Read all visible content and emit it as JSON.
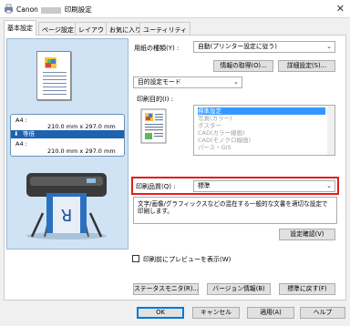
{
  "window": {
    "title_prefix": "Canon",
    "title_suffix": "印刷設定",
    "close_glyph": "✕"
  },
  "tabs": [
    {
      "label": "基本設定",
      "active": true
    },
    {
      "label": "ページ設定",
      "active": false
    },
    {
      "label": "レイアウト",
      "active": false
    },
    {
      "label": "お気に入り",
      "active": false
    },
    {
      "label": "ユーティリティ",
      "active": false
    }
  ],
  "preview": {
    "input_label": "A4 :",
    "input_size": "210.0 mm x 297.0 mm",
    "same_size_label": "等倍",
    "same_size_icon": "arrow-down-icon",
    "output_label": "A4 :",
    "output_size": "210.0 mm x 297.0 mm"
  },
  "media_type": {
    "label": "用紙の種類(Y) :",
    "value": "自動(プリンター設定に従う)"
  },
  "buttons": {
    "get_info": "情報の取得(O)...",
    "detail_settings": "詳細設定(S)...",
    "confirm_settings": "設定確認(V)",
    "status_monitor": "ステータスモニタ(R)...",
    "version_info": "バージョン情報(B)",
    "restore_defaults": "標準に戻す(F)",
    "ok": "OK",
    "cancel": "キャンセル",
    "apply": "適用(A)",
    "help": "ヘルプ"
  },
  "mode_select": {
    "value": "目的設定モード"
  },
  "print_target": {
    "label": "印刷目的(I) :",
    "options": [
      {
        "label": "標準設定",
        "selected": true,
        "enabled": true
      },
      {
        "label": "写真(カラー)",
        "selected": false,
        "enabled": false
      },
      {
        "label": "ポスター",
        "selected": false,
        "enabled": false
      },
      {
        "label": "CAD(カラー線画)",
        "selected": false,
        "enabled": false
      },
      {
        "label": "CAD(モノクロ線画)",
        "selected": false,
        "enabled": false
      },
      {
        "label": "パース・GIS",
        "selected": false,
        "enabled": false
      }
    ]
  },
  "print_quality": {
    "label": "印刷品質(Q) :",
    "value": "標準"
  },
  "description": "文字/画像/グラフィックスなどの混在する一般的な文書を適切な設定で印刷します。",
  "preview_checkbox": {
    "label": "印刷前にプレビューを表示(W)",
    "checked": false
  },
  "colors": {
    "accent": "#0078d7",
    "highlight": "#e21d1d",
    "selection": "#3399ff",
    "preview_bg": "#cfe3f4"
  }
}
